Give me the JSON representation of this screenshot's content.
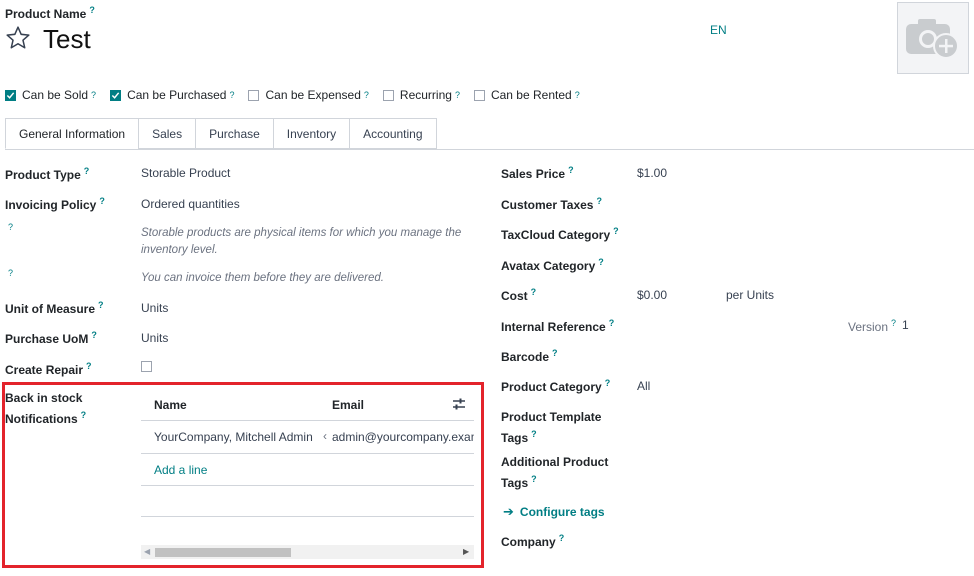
{
  "header": {
    "product_name_label": "Product Name",
    "product_title": "Test",
    "language": "EN"
  },
  "flags": [
    {
      "label": "Can be Sold",
      "checked": true
    },
    {
      "label": "Can be Purchased",
      "checked": true
    },
    {
      "label": "Can be Expensed",
      "checked": false
    },
    {
      "label": "Recurring",
      "checked": false
    },
    {
      "label": "Can be Rented",
      "checked": false
    }
  ],
  "tabs": [
    "General Information",
    "Sales",
    "Purchase",
    "Inventory",
    "Accounting"
  ],
  "left": {
    "product_type_label": "Product Type",
    "product_type": "Storable Product",
    "invoicing_policy_label": "Invoicing Policy",
    "invoicing_policy": "Ordered quantities",
    "hint_storable": "Storable products are physical items for which you manage the inventory level.",
    "hint_invoice": "You can invoice them before they are delivered.",
    "uom_label": "Unit of Measure",
    "uom": "Units",
    "purchase_uom_label": "Purchase UoM",
    "purchase_uom": "Units",
    "create_repair_label": "Create Repair",
    "notifications_label_1": "Back in stock",
    "notifications_label_2": "Notifications"
  },
  "notifications": {
    "col_name": "Name",
    "col_email": "Email",
    "row_name": "YourCompany, Mitchell Admin",
    "row_email": "admin@yourcompany.exam",
    "add_line": "Add a line"
  },
  "right": {
    "sales_price_label": "Sales Price",
    "sales_price": "$1.00",
    "customer_taxes_label": "Customer Taxes",
    "taxcloud_label": "TaxCloud Category",
    "avatax_label": "Avatax Category",
    "cost_label": "Cost",
    "cost": "$0.00",
    "cost_unit": "per Units",
    "internal_ref_label": "Internal Reference",
    "version_label": "Version",
    "version": "1",
    "barcode_label": "Barcode",
    "category_label": "Product Category",
    "category": "All",
    "template_tags_label_1": "Product Template",
    "template_tags_label_2": "Tags",
    "additional_tags_label_1": "Additional Product",
    "additional_tags_label_2": "Tags",
    "configure_tags": "Configure tags",
    "company_label": "Company"
  },
  "colors": {
    "accent": "#017e84",
    "highlight": "#e3232b"
  }
}
